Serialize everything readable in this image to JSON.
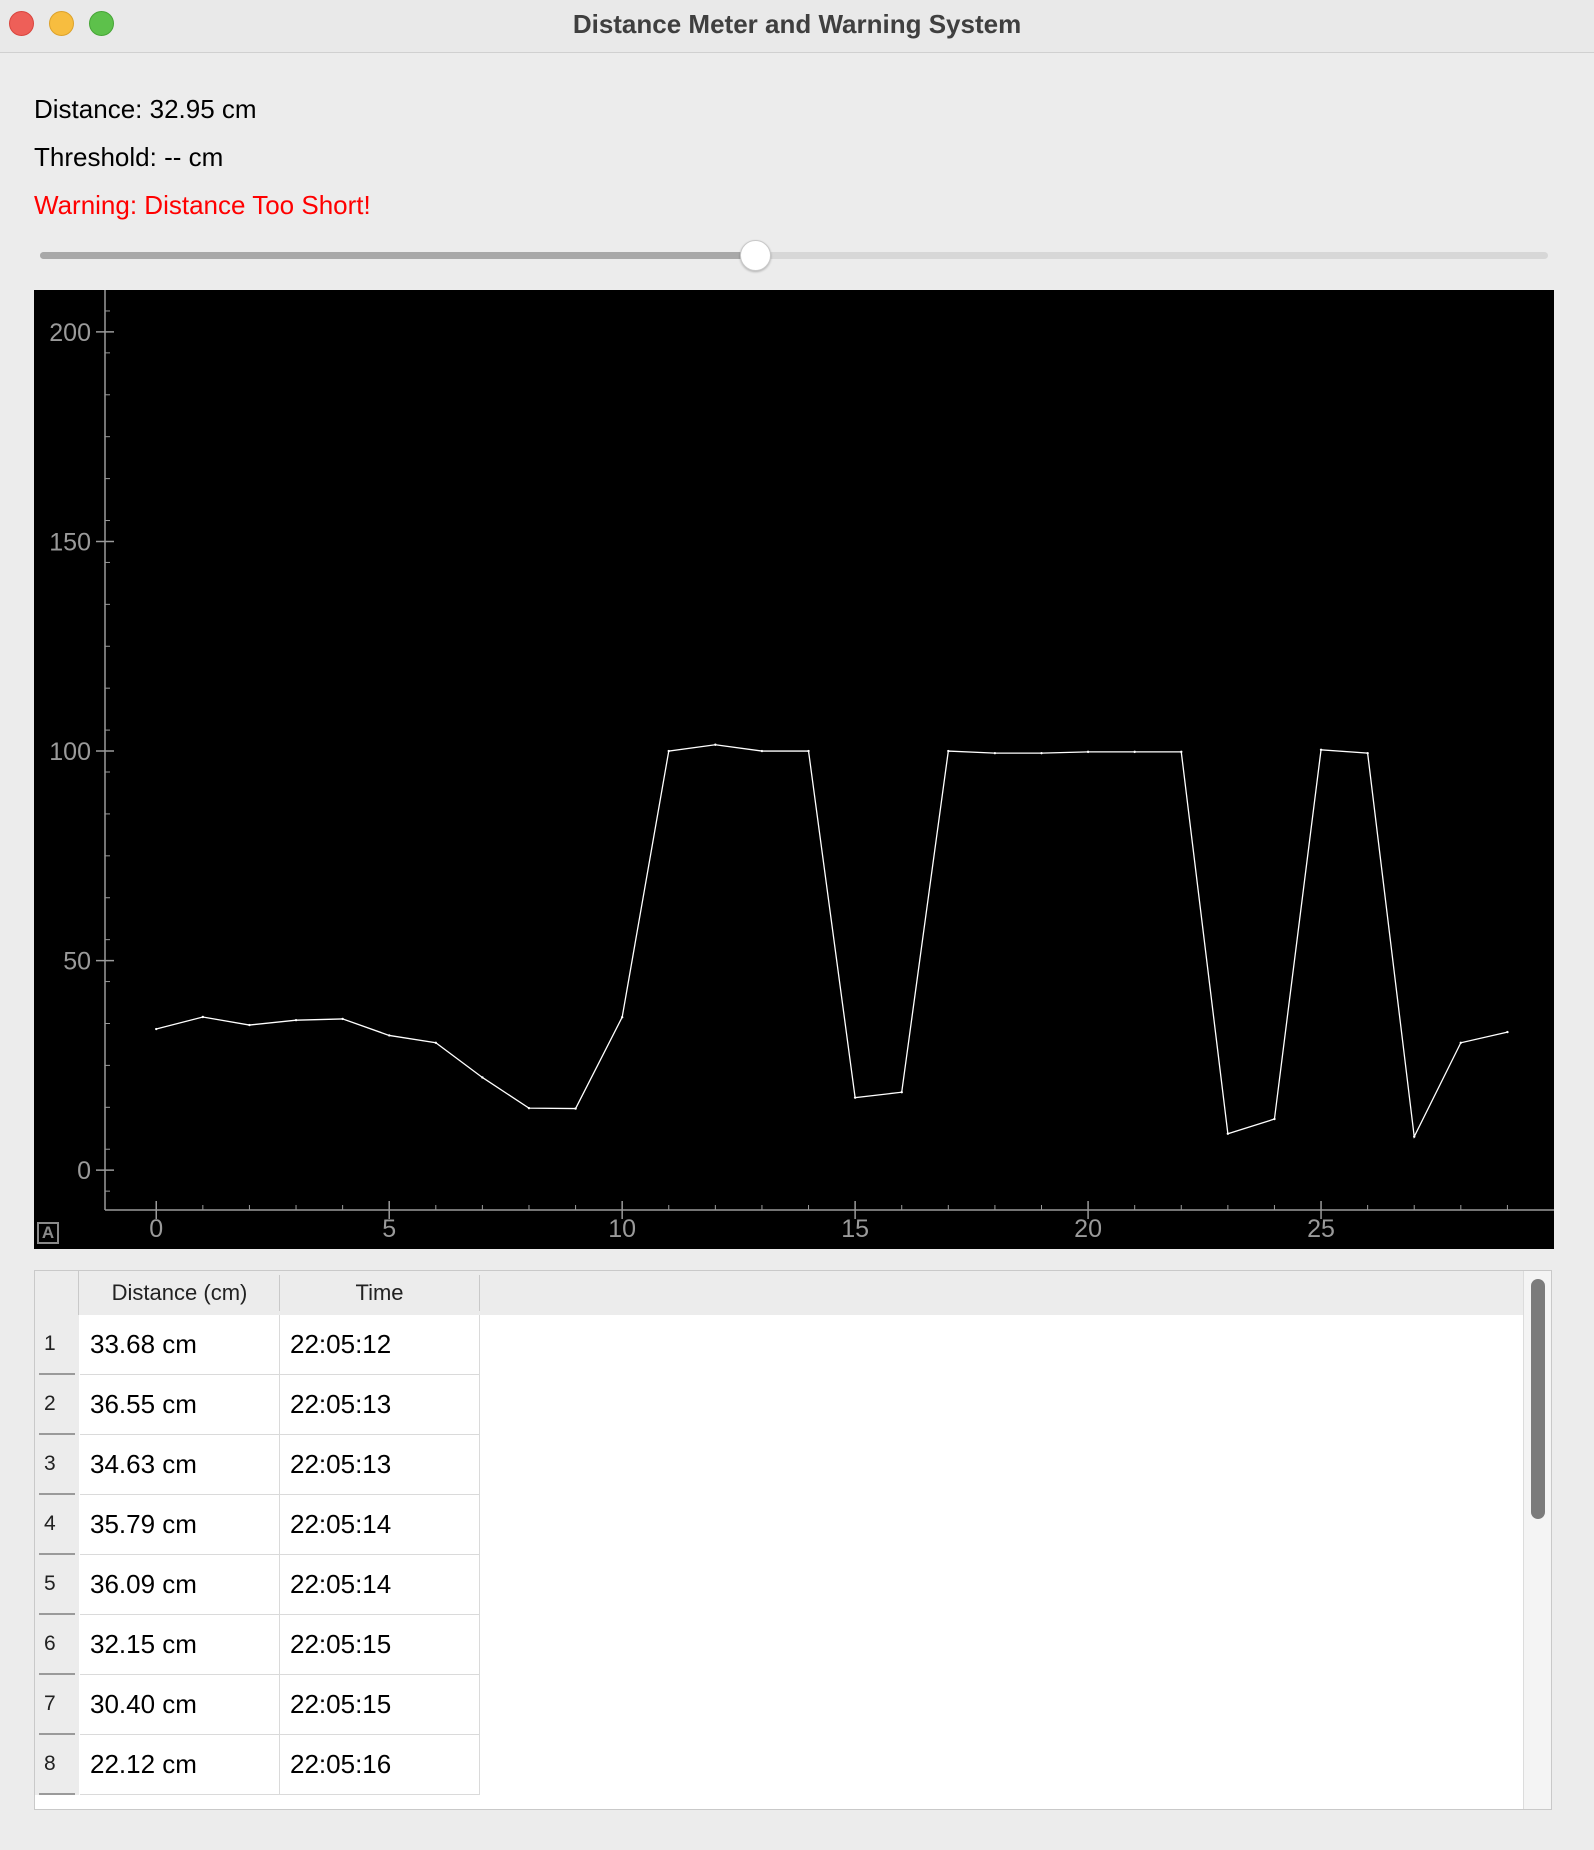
{
  "window": {
    "title": "Distance Meter and Warning System"
  },
  "info": {
    "distance": "Distance: 32.95 cm",
    "threshold": "Threshold: -- cm",
    "warning": "Warning: Distance Too Short!"
  },
  "slider": {
    "value_fraction": 0.474
  },
  "plot": {
    "autoscale_label": "A"
  },
  "chart_data": {
    "type": "line",
    "x": [
      0,
      1,
      2,
      3,
      4,
      5,
      6,
      7,
      8,
      9,
      10,
      11,
      12,
      13,
      14,
      15,
      16,
      17,
      18,
      19,
      20,
      21,
      22,
      23,
      24,
      25,
      26,
      27,
      28,
      29
    ],
    "series": [
      {
        "values": [
          33.68,
          36.55,
          34.63,
          35.79,
          36.09,
          32.15,
          30.4,
          22.12,
          14.8,
          14.7,
          36.5,
          100.0,
          101.5,
          100.0,
          100.0,
          17.3,
          18.6,
          100.0,
          99.5,
          99.5,
          99.8,
          99.8,
          99.8,
          8.7,
          12.2,
          100.3,
          99.5,
          8.0,
          30.4,
          32.95
        ],
        "color": "#ffffff"
      }
    ],
    "xlim": [
      -1.1,
      30
    ],
    "ylim": [
      -9.5,
      210
    ],
    "xticks": [
      0,
      5,
      10,
      15,
      20,
      25
    ],
    "yticks": [
      0,
      50,
      100,
      150,
      200
    ],
    "grid": false,
    "background": "#000000",
    "axis_color": "#9a9a9a"
  },
  "table": {
    "columns": [
      "Distance (cm)",
      "Time"
    ],
    "rows": [
      {
        "num": "1",
        "distance": "33.68 cm",
        "time": "22:05:12"
      },
      {
        "num": "2",
        "distance": "36.55 cm",
        "time": "22:05:13"
      },
      {
        "num": "3",
        "distance": "34.63 cm",
        "time": "22:05:13"
      },
      {
        "num": "4",
        "distance": "35.79 cm",
        "time": "22:05:14"
      },
      {
        "num": "5",
        "distance": "36.09 cm",
        "time": "22:05:14"
      },
      {
        "num": "6",
        "distance": "32.15 cm",
        "time": "22:05:15"
      },
      {
        "num": "7",
        "distance": "30.40 cm",
        "time": "22:05:15"
      },
      {
        "num": "8",
        "distance": "22.12 cm",
        "time": "22:05:16"
      }
    ]
  }
}
